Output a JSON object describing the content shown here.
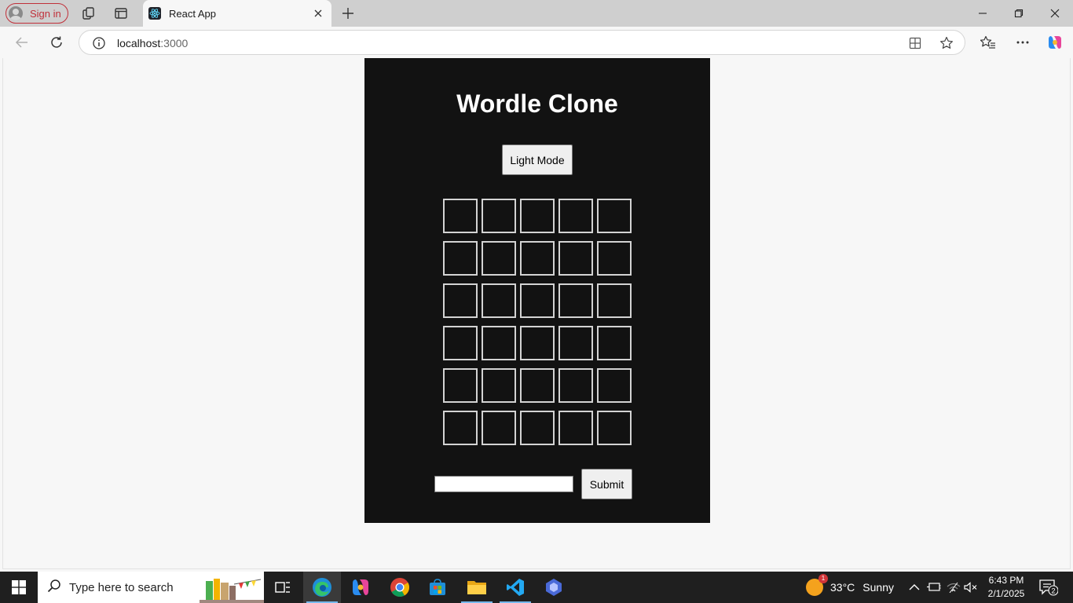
{
  "browser": {
    "signin_label": "Sign in",
    "tab_title": "React App",
    "url_host": "localhost",
    "url_port": ":3000"
  },
  "app": {
    "title": "Wordle Clone",
    "mode_button": "Light Mode",
    "grid": {
      "rows": 6,
      "cols": 5
    },
    "guess_input_value": "",
    "submit_button": "Submit"
  },
  "taskbar": {
    "search_placeholder": "Type here to search",
    "weather_temp": "33°C",
    "weather_text": "Sunny",
    "weather_badge": "1",
    "time": "6:43 PM",
    "date": "2/1/2025",
    "notification_count": "2"
  },
  "icons": {
    "accent": "#76b9ed",
    "signin_color": "#c0303a"
  }
}
